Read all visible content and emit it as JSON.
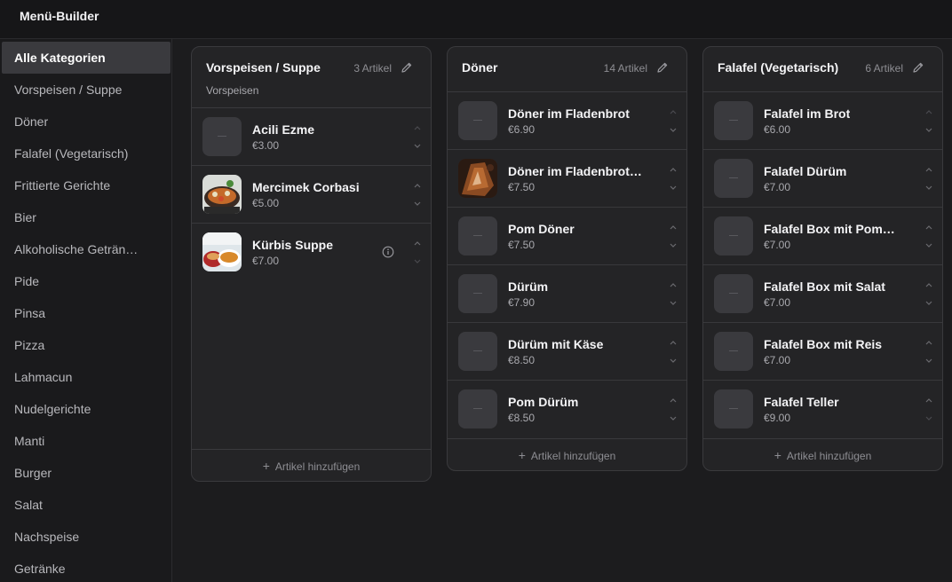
{
  "app": {
    "title": "Menü-Builder"
  },
  "sidebar": {
    "items": [
      {
        "label": "Alle Kategorien",
        "active": true
      },
      {
        "label": "Vorspeisen / Suppe"
      },
      {
        "label": "Döner"
      },
      {
        "label": "Falafel (Vegetarisch)"
      },
      {
        "label": "Frittierte Gerichte"
      },
      {
        "label": "Bier"
      },
      {
        "label": "Alkoholische Geträn…"
      },
      {
        "label": "Pide"
      },
      {
        "label": "Pinsa"
      },
      {
        "label": "Pizza"
      },
      {
        "label": "Lahmacun"
      },
      {
        "label": "Nudelgerichte"
      },
      {
        "label": "Manti"
      },
      {
        "label": "Burger"
      },
      {
        "label": "Salat"
      },
      {
        "label": "Nachspeise"
      },
      {
        "label": "Getränke"
      }
    ]
  },
  "columns": [
    {
      "title": "Vorspeisen / Suppe",
      "count": "3 Artikel",
      "subtitle": "Vorspeisen",
      "add_label": "Artikel hinzufügen",
      "items": [
        {
          "name": "Acili Ezme",
          "price": "€3.00",
          "image": "placeholder"
        },
        {
          "name": "Mercimek Corbasi",
          "price": "€5.00",
          "image": "food-photo"
        },
        {
          "name": "Kürbis Suppe",
          "price": "€7.00",
          "image": "food-photo"
        }
      ]
    },
    {
      "title": "Döner",
      "count": "14 Artikel",
      "add_label": "Artikel hinzufügen",
      "items": [
        {
          "name": "Döner im Fladenbrot",
          "price": "€6.90",
          "image": "placeholder"
        },
        {
          "name": "Döner im Fladenbrot …",
          "price": "€7.50",
          "image": "food-photo"
        },
        {
          "name": "Pom Döner",
          "price": "€7.50",
          "image": "placeholder"
        },
        {
          "name": "Dürüm",
          "price": "€7.90",
          "image": "placeholder"
        },
        {
          "name": "Dürüm mit Käse",
          "price": "€8.50",
          "image": "placeholder"
        },
        {
          "name": "Pom Dürüm",
          "price": "€8.50",
          "image": "placeholder"
        }
      ]
    },
    {
      "title": "Falafel (Vegetarisch)",
      "count": "6 Artikel",
      "add_label": "Artikel hinzufügen",
      "items": [
        {
          "name": "Falafel im Brot",
          "price": "€6.00",
          "image": "placeholder"
        },
        {
          "name": "Falafel Dürüm",
          "price": "€7.00",
          "image": "placeholder"
        },
        {
          "name": "Falafel Box mit Pom…",
          "price": "€7.00",
          "image": "placeholder"
        },
        {
          "name": "Falafel Box mit Salat",
          "price": "€7.00",
          "image": "placeholder"
        },
        {
          "name": "Falafel Box mit Reis",
          "price": "€7.00",
          "image": "placeholder"
        },
        {
          "name": "Falafel Teller",
          "price": "€9.00",
          "image": "placeholder"
        }
      ]
    }
  ],
  "colors": {
    "background": "#1c1c1e",
    "card": "#242426",
    "border": "#3a3a3d",
    "text_primary": "#f4f4f6",
    "text_muted": "#8e8e93"
  }
}
